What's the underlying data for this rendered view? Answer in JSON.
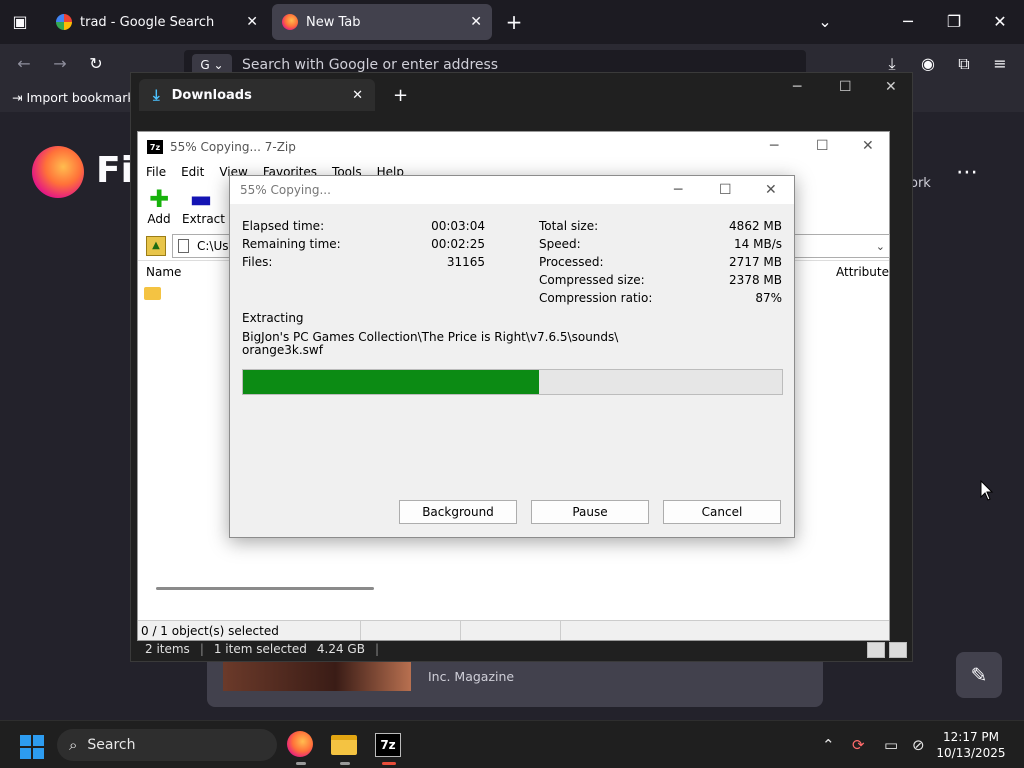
{
  "browser": {
    "tabs": [
      {
        "title": "trad - Google Search"
      },
      {
        "title": "New Tab"
      }
    ],
    "url_placeholder": "Search with Google or enter address",
    "bookmark_import": "Import bookmarks",
    "logo_text": "Fi",
    "work_label": "ork",
    "card_source": "Inc. Magazine"
  },
  "downloads_window": {
    "tab_title": "Downloads",
    "status": {
      "items": "2 items",
      "selected": "1 item selected",
      "size": "4.24 GB"
    }
  },
  "sevenzip": {
    "title": "55% Copying... 7-Zip",
    "menu": [
      "File",
      "Edit",
      "View",
      "Favorites",
      "Tools",
      "Help"
    ],
    "toolbar": {
      "add": "Add",
      "extract": "Extract"
    },
    "path": "C:\\Use",
    "columns": {
      "name": "Name",
      "attributes": "Attribute"
    },
    "status": "0 / 1 object(s) selected"
  },
  "dialog": {
    "title": "55% Copying...",
    "left_stats": [
      {
        "label": "Elapsed time:",
        "value": "00:03:04"
      },
      {
        "label": "Remaining time:",
        "value": "00:02:25"
      },
      {
        "label": "Files:",
        "value": "31165"
      }
    ],
    "right_stats": [
      {
        "label": "Total size:",
        "value": "4862 MB"
      },
      {
        "label": "Speed:",
        "value": "14 MB/s"
      },
      {
        "label": "Processed:",
        "value": "2717 MB"
      },
      {
        "label": "Compressed size:",
        "value": "2378 MB"
      },
      {
        "label": "Compression ratio:",
        "value": "87%"
      }
    ],
    "operation": "Extracting",
    "path_line1": "BigJon's PC Games Collection\\The Price is Right\\v7.6.5\\sounds\\",
    "path_line2": "orange3k.swf",
    "progress_fraction": 0.55,
    "buttons": {
      "background": "Background",
      "pause": "Pause",
      "cancel": "Cancel"
    }
  },
  "taskbar": {
    "search_label": "Search",
    "time": "12:17 PM",
    "date": "10/13/2025"
  }
}
